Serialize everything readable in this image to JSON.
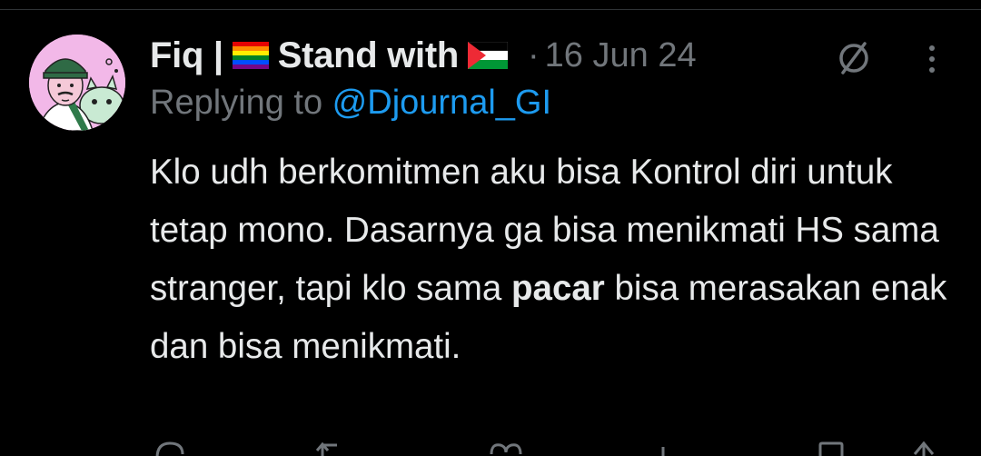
{
  "tweet": {
    "author_name_prefix": "Fiq |",
    "author_name_middle": "Stand with",
    "separator": "·",
    "date": "16 Jun 24",
    "reply_prefix": "Replying to ",
    "reply_handle": "@Djournal_GI",
    "body_part1": "Klo udh berkomitmen aku bisa Kontrol diri untuk tetap mono. Dasarnya ga bisa menikmati HS sama stranger, tapi klo sama ",
    "body_bold": "pacar",
    "body_part2": " bisa merasakan enak dan bisa menikmati."
  },
  "icons": {
    "flag1": "rainbow-flag-icon",
    "flag2": "palestine-flag-icon",
    "grok": "grok-icon",
    "more": "more-options-icon"
  },
  "colors": {
    "background": "#000000",
    "text_primary": "#e7e9ea",
    "text_secondary": "#71767b",
    "link": "#1d9bf0",
    "avatar_bg": "#f2b8e8"
  }
}
